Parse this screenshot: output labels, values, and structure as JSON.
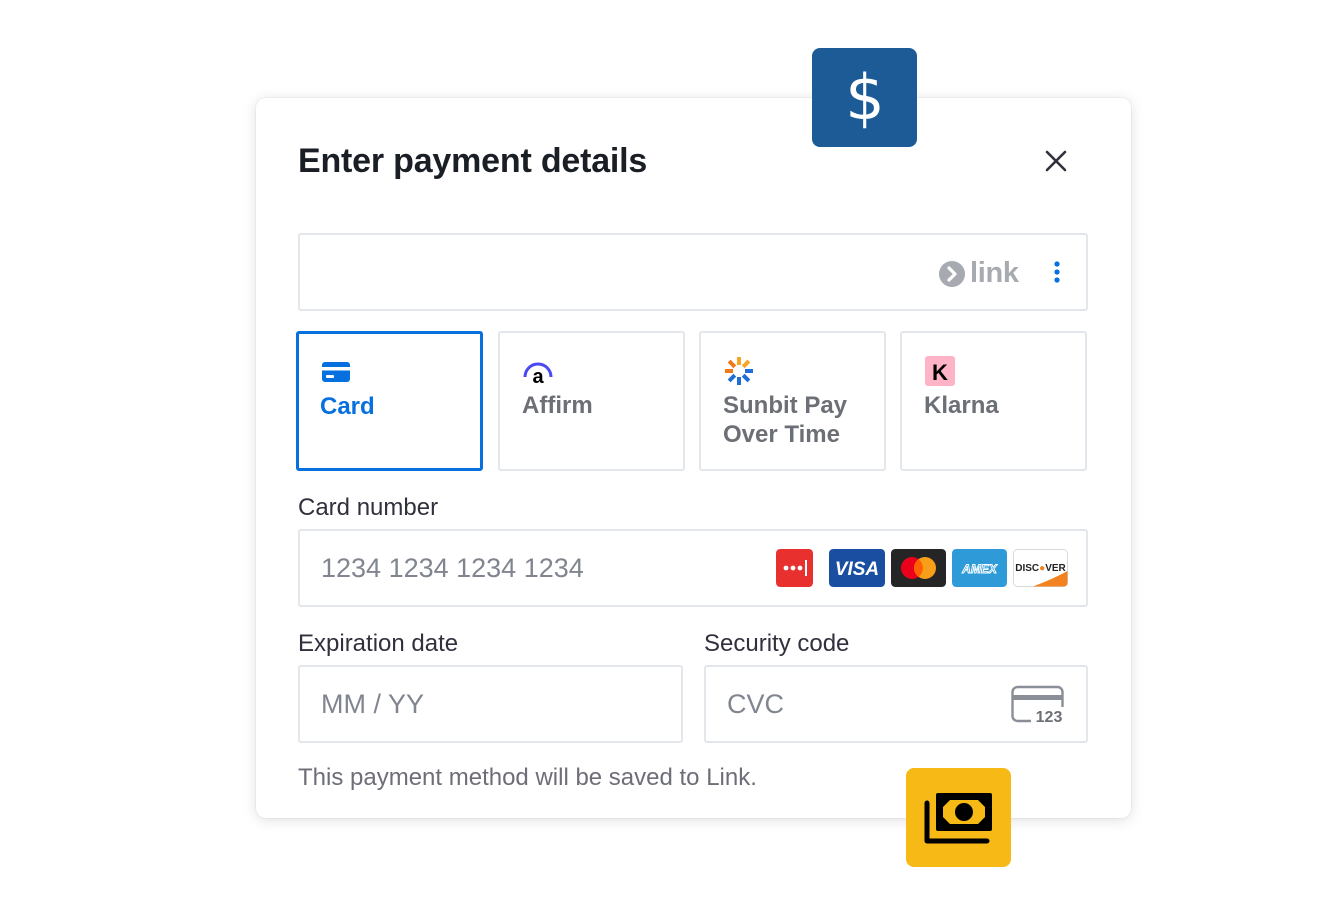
{
  "modal": {
    "title": "Enter payment details",
    "close_label": "×"
  },
  "link": {
    "logo_text": "link"
  },
  "tabs": [
    {
      "label": "Card",
      "active": true,
      "icon": "credit-card-icon"
    },
    {
      "label": "Affirm",
      "active": false,
      "icon": "affirm-logo-icon"
    },
    {
      "label": "Sunbit Pay Over Time",
      "active": false,
      "icon": "sunbit-logo-icon"
    },
    {
      "label": "Klarna",
      "active": false,
      "icon": "klarna-logo-icon"
    }
  ],
  "card_number": {
    "label": "Card number",
    "placeholder": "1234 1234 1234 1234",
    "brands": [
      "Visa",
      "Mastercard",
      "Amex",
      "Discover"
    ]
  },
  "expiration": {
    "label": "Expiration date",
    "placeholder": "MM / YY"
  },
  "security": {
    "label": "Security code",
    "placeholder": "CVC",
    "cvc_icon_text": "123"
  },
  "footnote": "This payment method will be saved to Link.",
  "badges": {
    "dollar_symbol": "$"
  },
  "colors": {
    "accent": "#0570de",
    "border": "#e3e6ea",
    "dollar_badge": "#1d5b97",
    "money_badge": "#f7b916",
    "link_grey": "#a7aab0"
  }
}
